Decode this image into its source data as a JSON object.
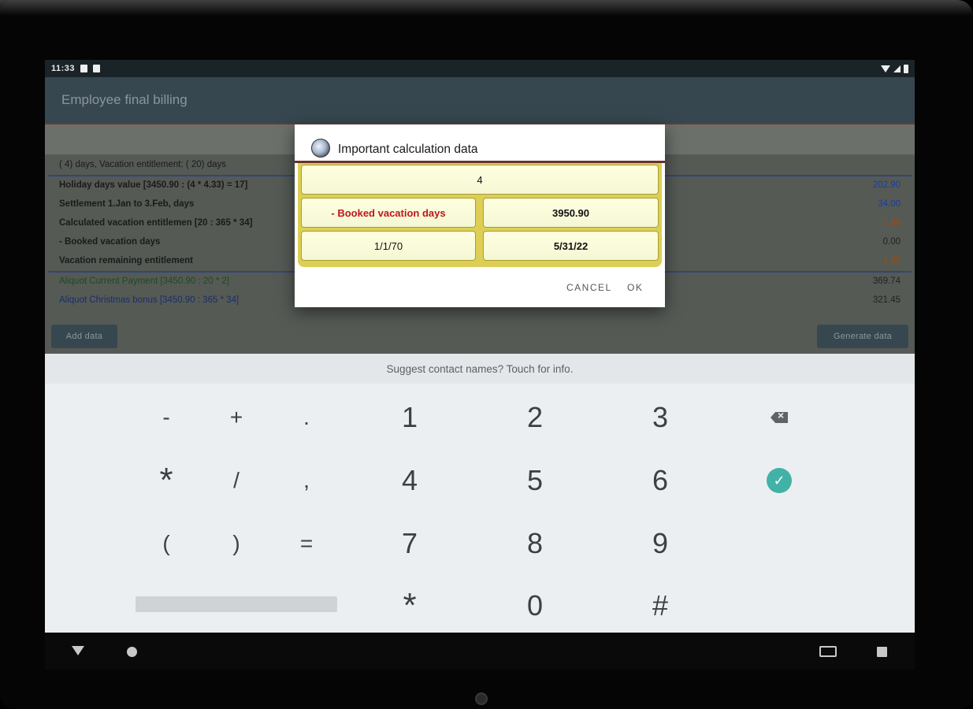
{
  "status_bar": {
    "time": "11:33"
  },
  "app_bar": {
    "title": "Employee final billing"
  },
  "table": {
    "rows": [
      {
        "label": "( 4) days, Vacation entitlement: ( 20) days",
        "value": "",
        "style": "header"
      },
      {
        "label": "Holiday days value [3450.90 : (4 * 4.33) = 17]",
        "value": "202.90",
        "style": "bold",
        "value_color": "blue"
      },
      {
        "label": "Settlement 1.Jan to 3.Feb, days",
        "value": "34.00",
        "style": "bold",
        "value_color": "blue"
      },
      {
        "label": "Calculated vacation entitlemen [20 : 365 * 34]",
        "value": "1.86",
        "style": "bold",
        "value_color": "orange"
      },
      {
        "label": "- Booked vacation days",
        "value": "0.00",
        "style": "bold",
        "value_color": "dark"
      },
      {
        "label": "Vacation remaining entitlement",
        "value": "1.86",
        "style": "bold",
        "value_color": "orange"
      },
      {
        "label": "Aliquot Current Payment [3450.90 : 20 * 2]",
        "value": "369.74",
        "style": "green",
        "value_color": "dark"
      },
      {
        "label": "Aliquot Christmas bonus [3450.90 : 365 * 34]",
        "value": "321.45",
        "style": "blue",
        "value_color": "dark"
      }
    ]
  },
  "buttons": {
    "add_data": "Add data",
    "generate_data": "Generate data"
  },
  "dialog": {
    "title": "Important calculation data",
    "cells": {
      "top": "4",
      "booked_label": "- Booked vacation days",
      "salary": "3950.90",
      "start_date": "1/1/70",
      "end_date": "5/31/22"
    },
    "cancel": "CANCEL",
    "ok": "OK"
  },
  "keyboard": {
    "suggestion": "Suggest contact names? Touch for info.",
    "sym_keys": [
      "-",
      "+",
      ".",
      "*",
      "/",
      ",",
      "(",
      ")",
      "="
    ],
    "num_keys": [
      "1",
      "2",
      "3",
      "4",
      "5",
      "6",
      "7",
      "8",
      "9",
      "*",
      "0",
      "#"
    ],
    "accent_color": "#42b2a6"
  }
}
